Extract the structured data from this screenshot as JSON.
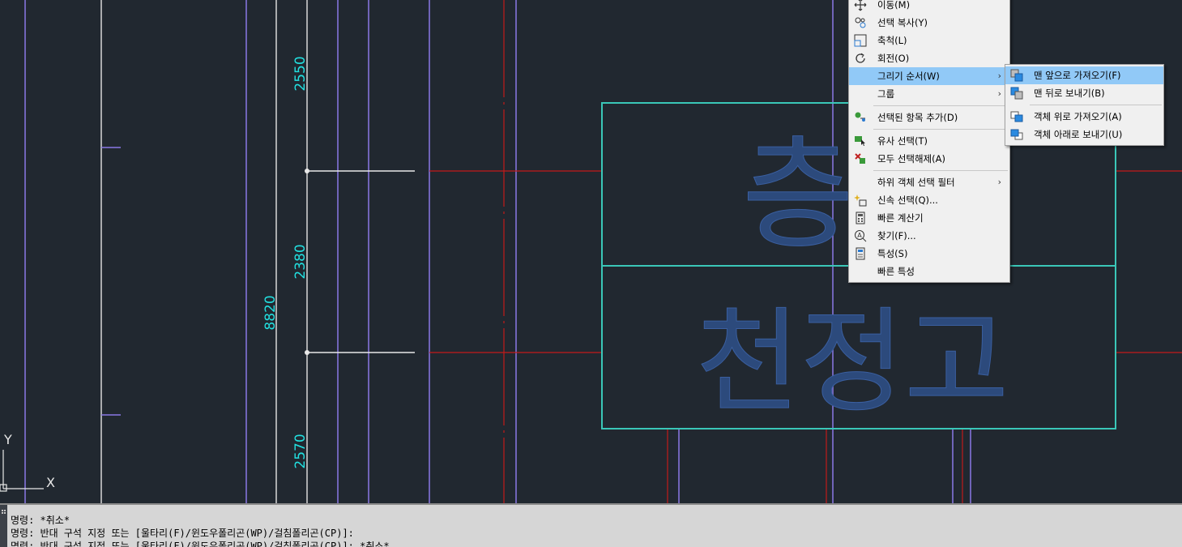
{
  "drawing": {
    "dimensions": [
      "2550",
      "2380",
      "2570",
      "8820"
    ],
    "room_labels": [
      "층",
      "천정고"
    ],
    "ucs_axes": [
      "Y",
      "X"
    ]
  },
  "context_menu": {
    "items": [
      {
        "label": "이동(M)",
        "icon": "move-icon"
      },
      {
        "label": "선택 복사(Y)",
        "icon": "copy-selection-icon"
      },
      {
        "label": "축척(L)",
        "icon": "scale-icon"
      },
      {
        "label": "회전(O)",
        "icon": "rotate-icon"
      },
      {
        "label": "그리기 순서(W)",
        "submenu": true,
        "highlighted": true
      },
      {
        "label": "그룹",
        "submenu": true
      },
      {
        "label": "선택된 항목 추가(D)",
        "icon": "add-selected-icon"
      },
      {
        "label": "유사 선택(T)",
        "icon": "select-similar-icon"
      },
      {
        "label": "모두 선택해제(A)",
        "icon": "deselect-all-icon"
      },
      {
        "label": "하위 객체 선택 필터",
        "submenu": true
      },
      {
        "label": "신속 선택(Q)...",
        "icon": "quick-select-icon"
      },
      {
        "label": "빠른 계산기",
        "icon": "calculator-icon"
      },
      {
        "label": "찾기(F)...",
        "icon": "find-icon"
      },
      {
        "label": "특성(S)",
        "icon": "properties-icon"
      },
      {
        "label": "빠른 특성"
      }
    ]
  },
  "draw_order_submenu": {
    "items": [
      {
        "label": "맨 앞으로 가져오기(F)",
        "icon": "bring-to-front-icon",
        "highlighted": true
      },
      {
        "label": "맨 뒤로 보내기(B)",
        "icon": "send-to-back-icon"
      },
      {
        "label": "객체 위로 가져오기(A)",
        "icon": "bring-above-objects-icon"
      },
      {
        "label": "객체 아래로 보내기(U)",
        "icon": "send-under-objects-icon"
      }
    ]
  },
  "command_line": {
    "lines": [
      "명령: *취소*",
      "명령: 반대 구석 지정 또는 [울타리(F)/윈도우폴리곤(WP)/걸침폴리곤(CP)]:",
      "명령: 반대 구석 지정 또는 [울타리(F)/윈도우폴리곤(WP)/걸침폴리곤(CP)]: *취소*"
    ]
  },
  "colors": {
    "background": "#212830",
    "purple_line": "#8a78e6",
    "red_line": "#c21a1a",
    "cyan_dim": "#22e0e0",
    "box_outline": "#3ac7b8",
    "label_fill": "#2c4a7c",
    "menu_highlight": "#91c9f7"
  }
}
